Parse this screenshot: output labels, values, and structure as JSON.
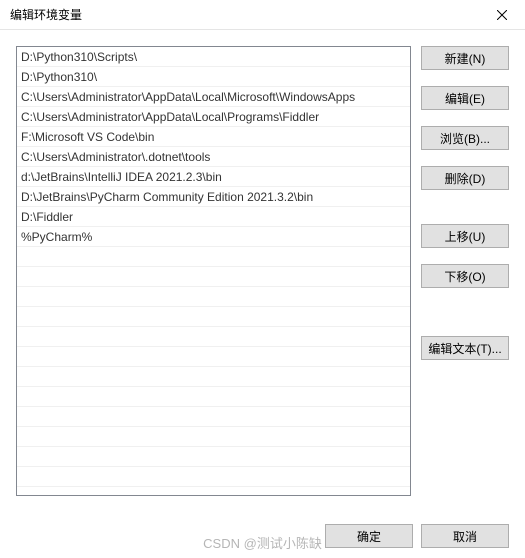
{
  "window": {
    "title": "编辑环境变量"
  },
  "list": {
    "items": [
      "D:\\Python310\\Scripts\\",
      "D:\\Python310\\",
      "C:\\Users\\Administrator\\AppData\\Local\\Microsoft\\WindowsApps",
      "C:\\Users\\Administrator\\AppData\\Local\\Programs\\Fiddler",
      "F:\\Microsoft VS Code\\bin",
      "C:\\Users\\Administrator\\.dotnet\\tools",
      "d:\\JetBrains\\IntelliJ IDEA 2021.2.3\\bin",
      "D:\\JetBrains\\PyCharm Community Edition 2021.3.2\\bin",
      "D:\\Fiddler",
      "%PyCharm%"
    ]
  },
  "buttons": {
    "new": "新建(N)",
    "edit": "编辑(E)",
    "browse": "浏览(B)...",
    "delete": "删除(D)",
    "moveup": "上移(U)",
    "movedown": "下移(O)",
    "edittext": "编辑文本(T)...",
    "ok": "确定",
    "cancel": "取消"
  },
  "watermark": "CSDN @测试小陈缺"
}
